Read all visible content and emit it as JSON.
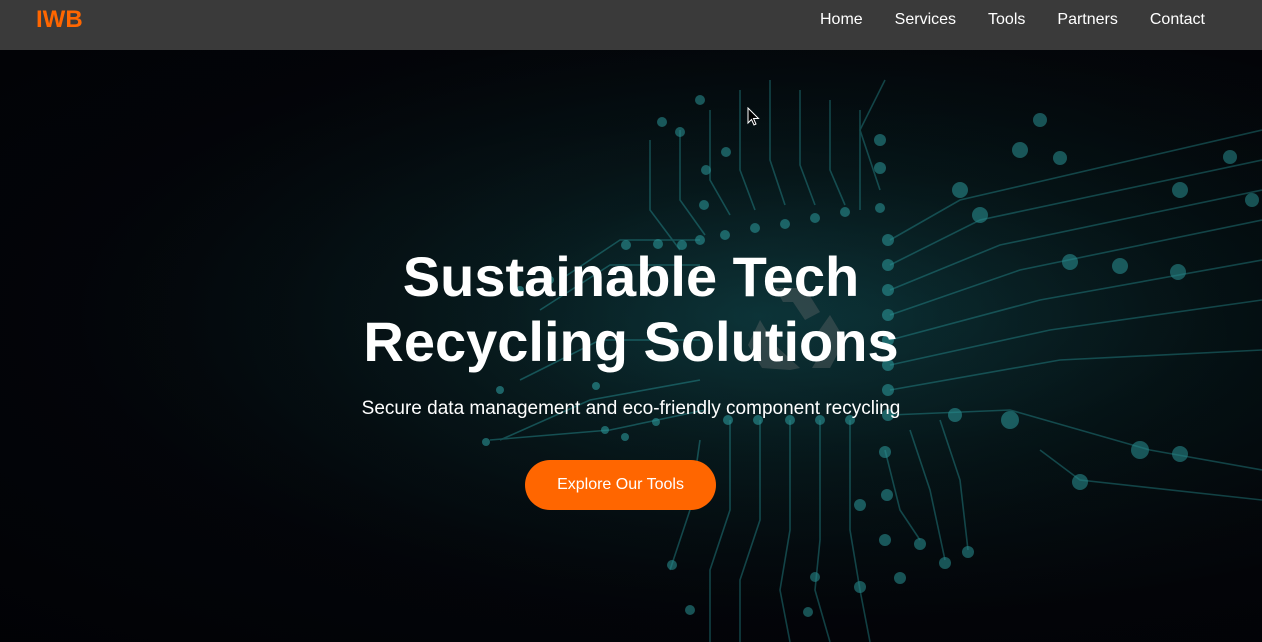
{
  "nav": {
    "logo": "IWB",
    "links": [
      {
        "label": "Home"
      },
      {
        "label": "Services"
      },
      {
        "label": "Tools"
      },
      {
        "label": "Partners"
      },
      {
        "label": "Contact"
      }
    ]
  },
  "hero": {
    "title_line1": "Sustainable Tech",
    "title_line2": "Recycling Solutions",
    "subtitle": "Secure data management and eco-friendly component recycling",
    "cta_label": "Explore Our Tools",
    "background_icon": "circuit-board-recycle-image"
  },
  "colors": {
    "accent": "#ff6600",
    "navbar": "#3a3a3a",
    "text": "#ffffff",
    "circuit": "#2fb5b8"
  }
}
